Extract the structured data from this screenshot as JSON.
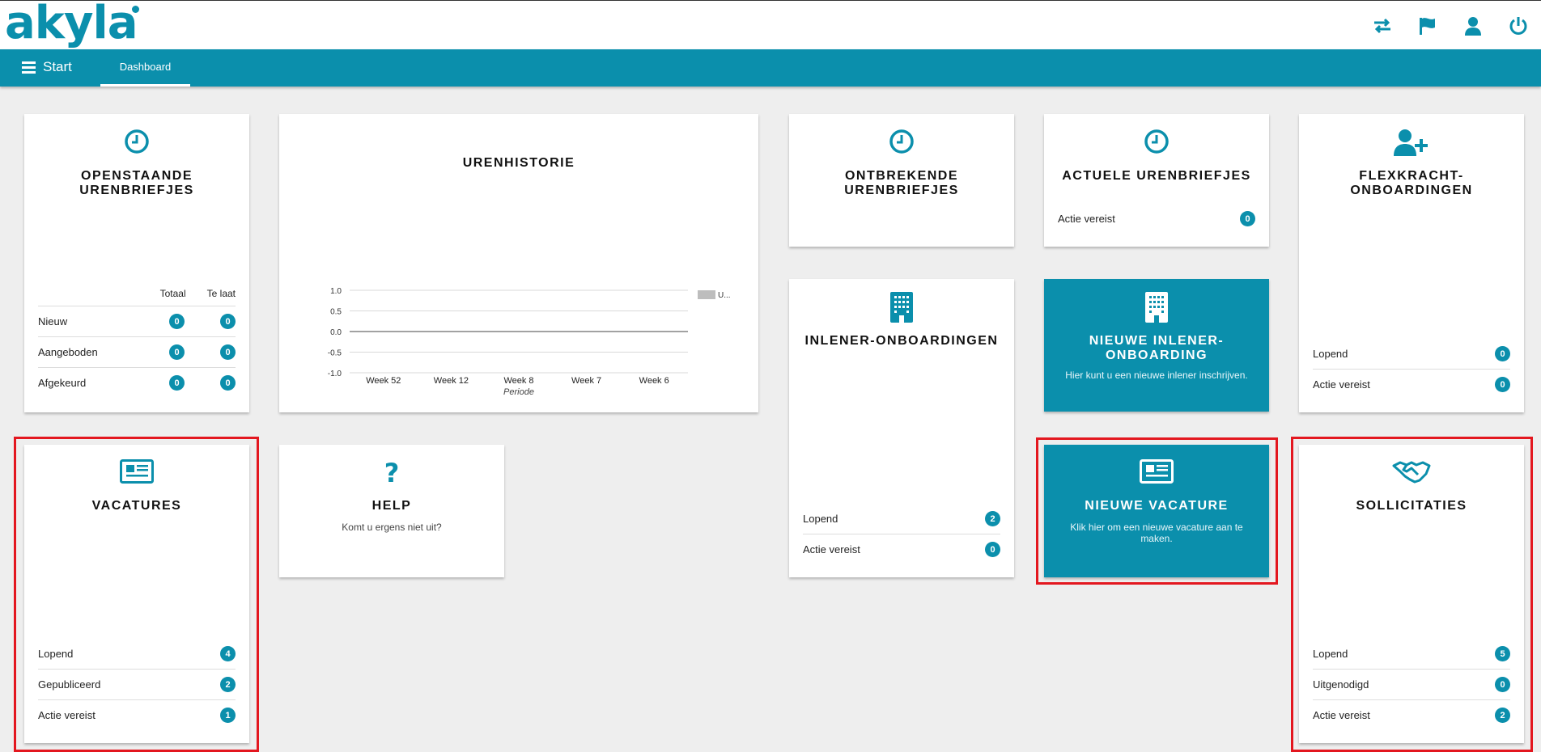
{
  "app": {
    "logo": "akyla"
  },
  "topbar": {
    "icons": [
      "switch-icon",
      "flag-icon",
      "user-icon",
      "power-icon"
    ]
  },
  "nav": {
    "start_label": "Start",
    "tab_dashboard": "Dashboard"
  },
  "colors": {
    "accent": "#0b8fac",
    "highlight": "#e3171f",
    "background": "#eeeeee"
  },
  "cards": {
    "openstaande": {
      "title": "OPENSTAANDE URENBRIEFJES",
      "col_totaal": "Totaal",
      "col_telaat": "Te laat",
      "rows": [
        {
          "label": "Nieuw",
          "totaal": "0",
          "telaat": "0"
        },
        {
          "label": "Aangeboden",
          "totaal": "0",
          "telaat": "0"
        },
        {
          "label": "Afgekeurd",
          "totaal": "0",
          "telaat": "0"
        }
      ]
    },
    "urenhistorie": {
      "title": "URENHISTORIE"
    },
    "ontbrekende": {
      "title": "ONTBREKENDE URENBRIEFJES"
    },
    "actuele": {
      "title": "ACTUELE URENBRIEFJES",
      "rows": [
        {
          "label": "Actie vereist",
          "value": "0"
        }
      ]
    },
    "flexkracht": {
      "title": "FLEXKRACHT-ONBOARDINGEN",
      "rows": [
        {
          "label": "Lopend",
          "value": "0"
        },
        {
          "label": "Actie vereist",
          "value": "0"
        }
      ]
    },
    "inlener": {
      "title": "INLENER-ONBOARDINGEN",
      "rows": [
        {
          "label": "Lopend",
          "value": "2"
        },
        {
          "label": "Actie vereist",
          "value": "0"
        }
      ]
    },
    "nieuwe_inlener": {
      "title": "NIEUWE INLENER-ONBOARDING",
      "subtitle": "Hier kunt u een nieuwe inlener inschrijven."
    },
    "vacatures": {
      "title": "VACATURES",
      "rows": [
        {
          "label": "Lopend",
          "value": "4"
        },
        {
          "label": "Gepubliceerd",
          "value": "2"
        },
        {
          "label": "Actie vereist",
          "value": "1"
        }
      ]
    },
    "help": {
      "title": "HELP",
      "subtitle": "Komt u ergens niet uit?"
    },
    "nieuwe_vacature": {
      "title": "NIEUWE VACATURE",
      "subtitle": "Klik hier om een nieuwe vacature aan te maken."
    },
    "sollicitaties": {
      "title": "SOLLICITATIES",
      "rows": [
        {
          "label": "Lopend",
          "value": "5"
        },
        {
          "label": "Uitgenodigd",
          "value": "0"
        },
        {
          "label": "Actie vereist",
          "value": "2"
        }
      ]
    }
  },
  "chart_data": {
    "type": "bar",
    "title": "URENHISTORIE",
    "xlabel": "Periode",
    "ylabel": "",
    "categories": [
      "Week 52",
      "Week 12",
      "Week 8",
      "Week 7",
      "Week 6"
    ],
    "series": [
      {
        "name": "U...",
        "values": [
          0,
          0,
          0,
          0,
          0
        ]
      }
    ],
    "y_ticks": [
      "1.0",
      "0.5",
      "0.0",
      "-0.5",
      "-1.0"
    ],
    "ylim": [
      -1.0,
      1.0
    ],
    "grid": true,
    "legend": "right"
  }
}
